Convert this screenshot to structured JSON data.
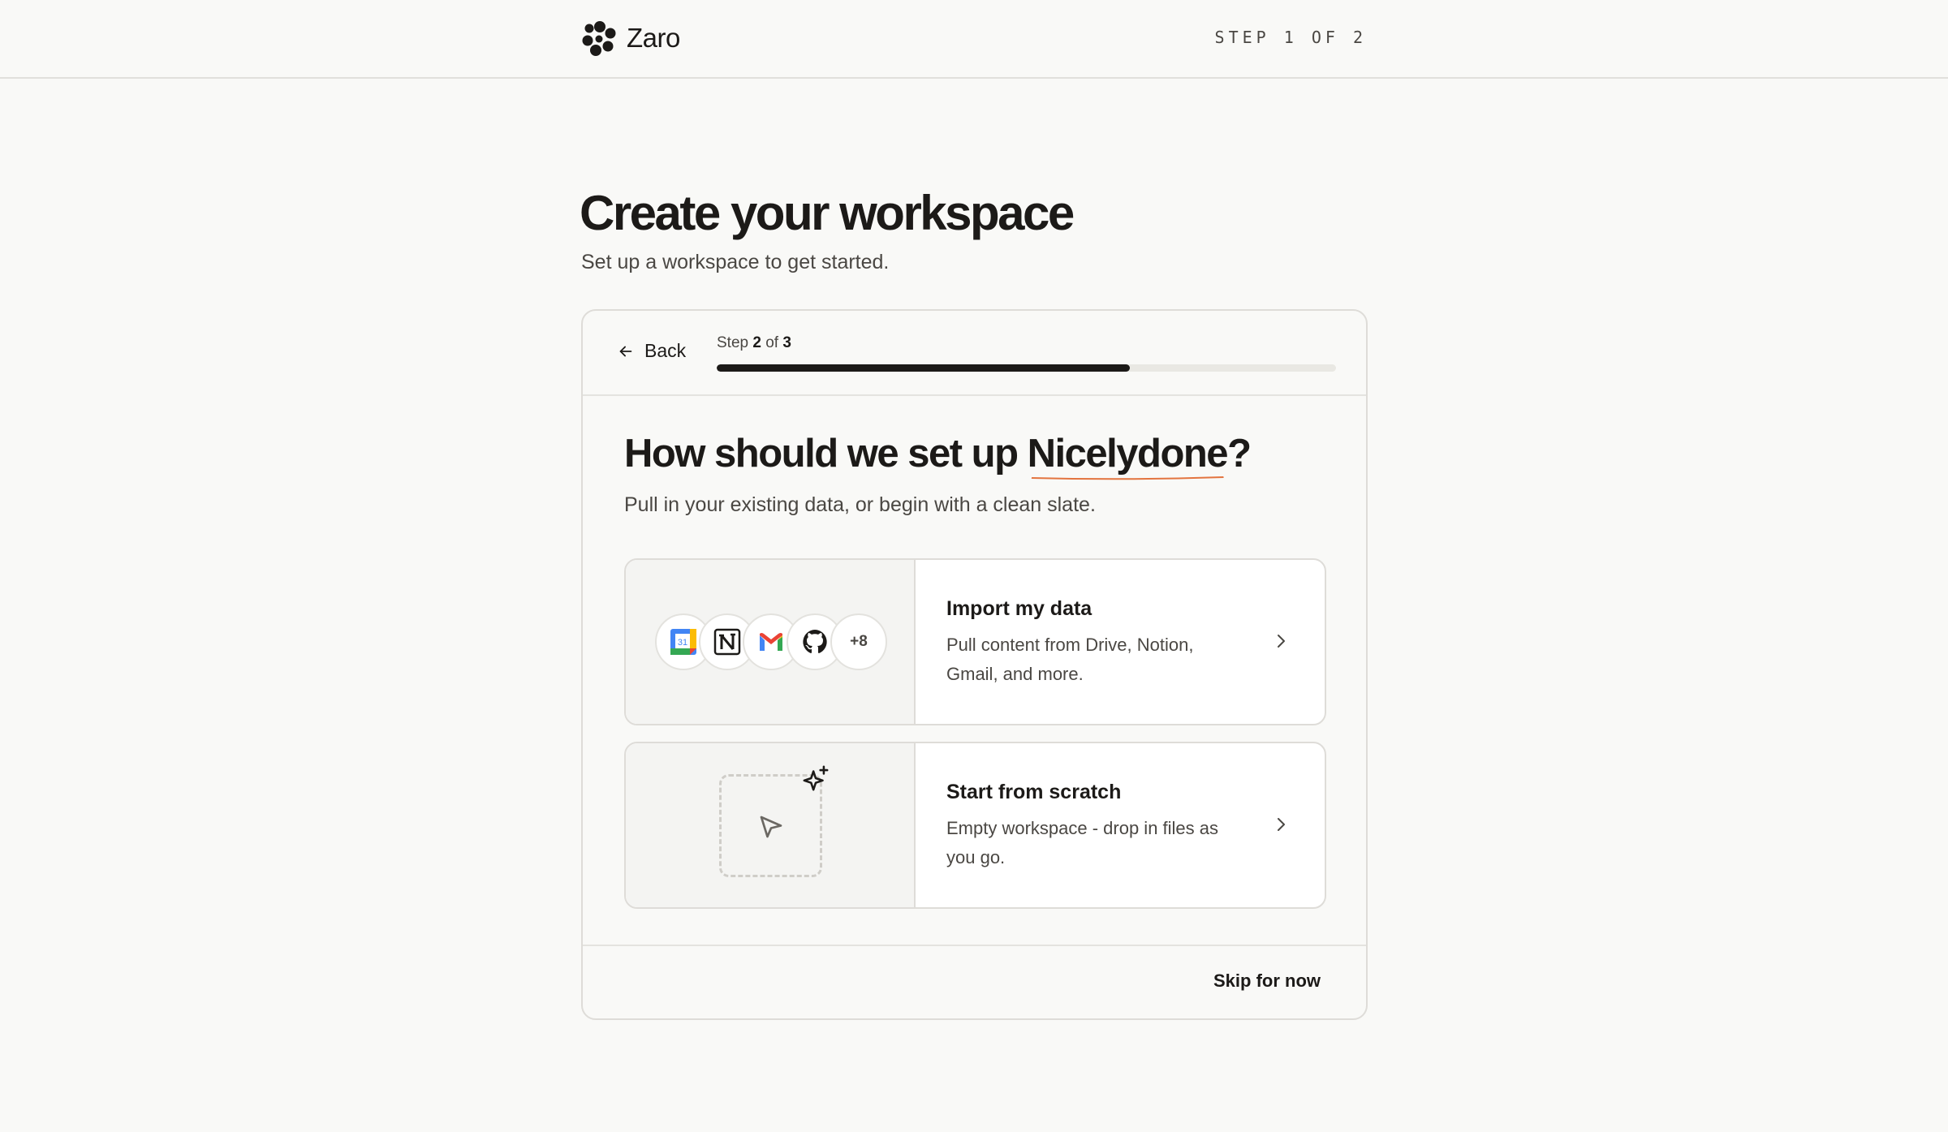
{
  "header": {
    "brand_name": "Zaro",
    "logo_icon": "flower-dots-logo",
    "step_indicator": "STEP 1 OF 2"
  },
  "page": {
    "title": "Create your workspace",
    "subtitle": "Set up a workspace to get started."
  },
  "card": {
    "back_label": "Back",
    "progress": {
      "step_word": "Step",
      "current": "2",
      "of_word": "of",
      "total": "3",
      "fraction": 0.667
    },
    "question_prefix": "How should we set up ",
    "question_name": "Nicelydone",
    "question_suffix": "?",
    "lead": "Pull in your existing data, or begin with a clean slate.",
    "options": [
      {
        "title": "Import my data",
        "description": "Pull content from Drive, Notion, Gmail, and more.",
        "integrations": [
          "google-calendar-icon",
          "notion-icon",
          "gmail-icon",
          "github-icon"
        ],
        "calendar_day": "31",
        "more_count": "+8"
      },
      {
        "title": "Start from scratch",
        "description": "Empty workspace - drop in files as you go."
      }
    ],
    "skip_label": "Skip for now"
  },
  "colors": {
    "background": "#f9f9f7",
    "text": "#1c1a18",
    "muted_text": "#4a4743",
    "progress_fill": "#1c1a18",
    "underline_accent": "#e3743f"
  }
}
